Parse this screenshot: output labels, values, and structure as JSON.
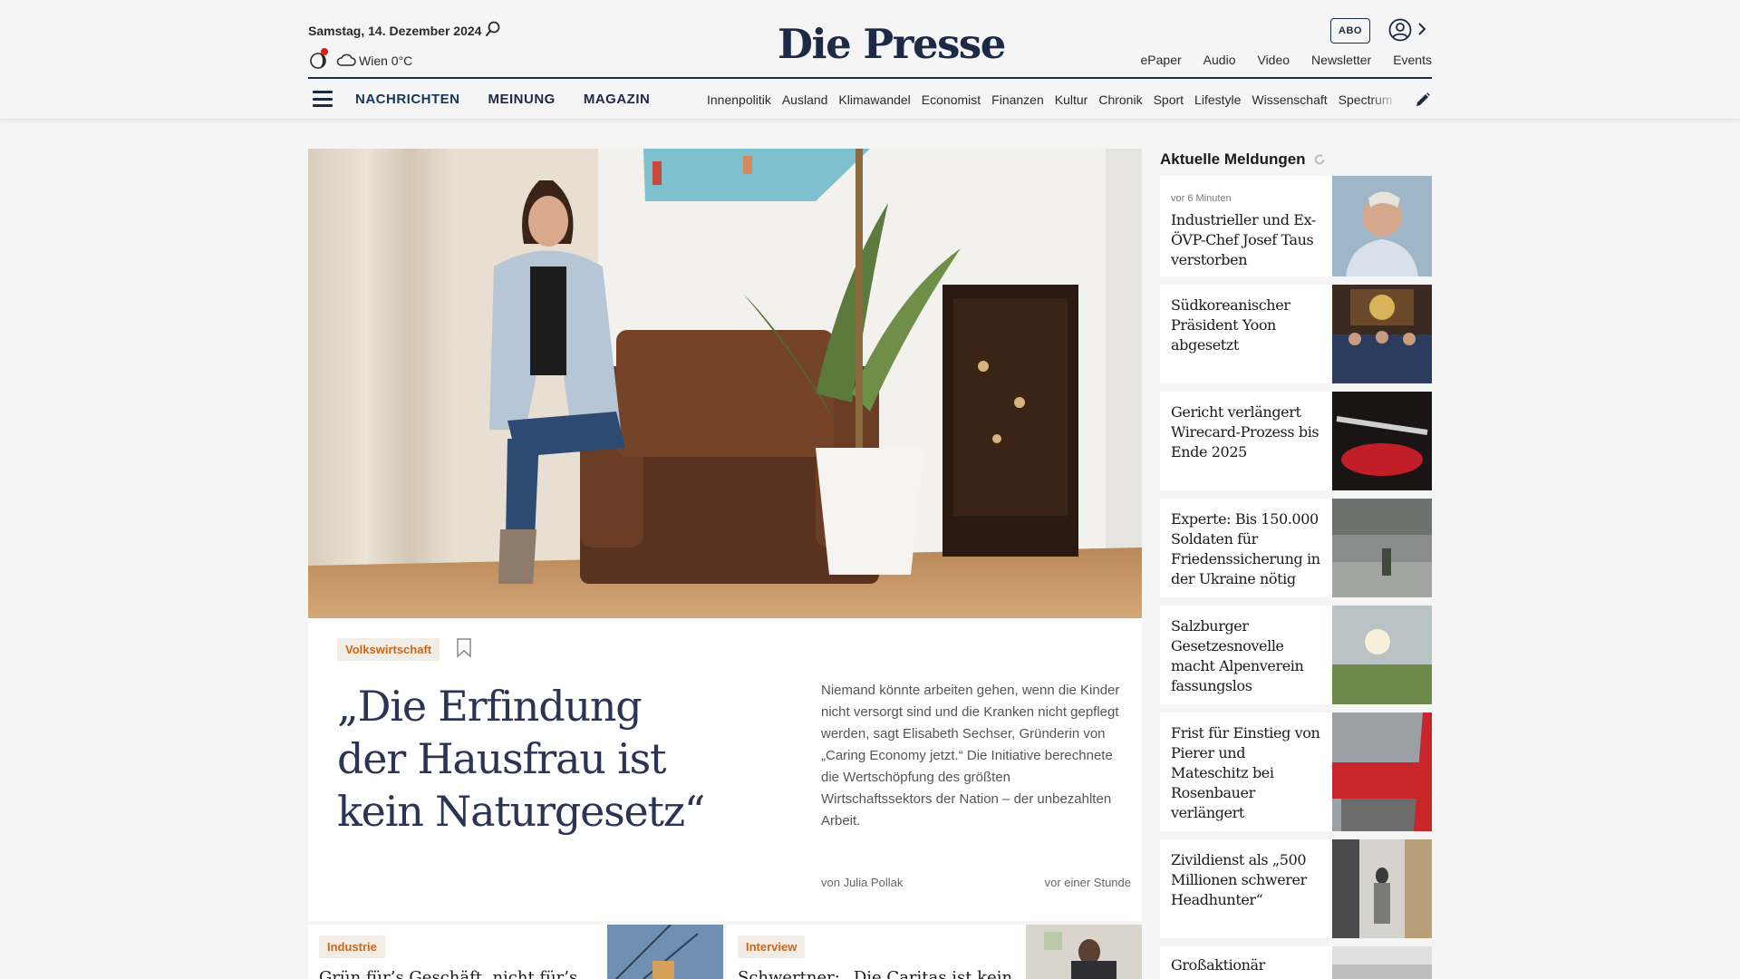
{
  "header": {
    "date": "Samstag, 14. Dezember 2024",
    "weather": "Wien 0°C",
    "logo": "Die Presse",
    "abo_label": "ABO",
    "service_links": [
      "ePaper",
      "Audio",
      "Video",
      "Newsletter",
      "Events"
    ],
    "main_nav": [
      "NACHRICHTEN",
      "MEINUNG",
      "MAGAZIN"
    ],
    "categories": [
      "Innenpolitik",
      "Ausland",
      "Klimawandel",
      "Economist",
      "Finanzen",
      "Kultur",
      "Chronik",
      "Sport",
      "Lifestyle",
      "Wissenschaft",
      "Spectrum"
    ]
  },
  "hero": {
    "tag": "Volkswirtschaft",
    "title": "„Die Erfindung der Hausfrau ist kein Naturgesetz“",
    "teaser": "Niemand könnte arbeiten gehen, wenn die Kinder nicht versorgt sind und die Kranken nicht gepflegt werden, sagt Elisabeth Sechser, Gründerin von „Caring Economy jetzt.“ Die Initiative berechnete die Wertschöpfung des größten Wirtschaftssektors der Nation – der unbezahlten Arbeit.",
    "author": "von Julia Pollak",
    "time": "vor einer Stunde"
  },
  "teasers": [
    {
      "tag": "Industrie",
      "title": "Grün für’s Geschäft, nicht für’s"
    },
    {
      "tag": "Interview",
      "title": "Schwertner: „Die Caritas ist kein"
    }
  ],
  "sidebar": {
    "heading": "Aktuelle Meldungen",
    "items": [
      {
        "meta": "vor 6 Minuten",
        "title": "Industrieller und Ex-ÖVP-Chef Josef Taus verstorben"
      },
      {
        "meta": "",
        "title": "Südkoreanischer Präsident Yoon abgesetzt"
      },
      {
        "meta": "",
        "title": "Gericht verlängert Wirecard-Prozess bis Ende 2025"
      },
      {
        "meta": "",
        "title": "Experte: Bis 150.000 Soldaten für Friedenssicherung in der Ukraine nötig"
      },
      {
        "meta": "",
        "title": "Salzburger Gesetzesnovelle macht Alpenverein fassungslos"
      },
      {
        "meta": "",
        "title": "Frist für Einstieg von Pierer und Mateschitz bei Rosenbauer verlängert"
      },
      {
        "meta": "",
        "title": "Zivildienst als „500 Millionen schwerer Headhunter“"
      },
      {
        "meta": "",
        "title": "Großaktionär"
      }
    ]
  },
  "colors": {
    "brand": "#1c2a46",
    "tag_text": "#c6691e",
    "tag_bg": "#f1ece6",
    "headline": "#2c3354"
  }
}
